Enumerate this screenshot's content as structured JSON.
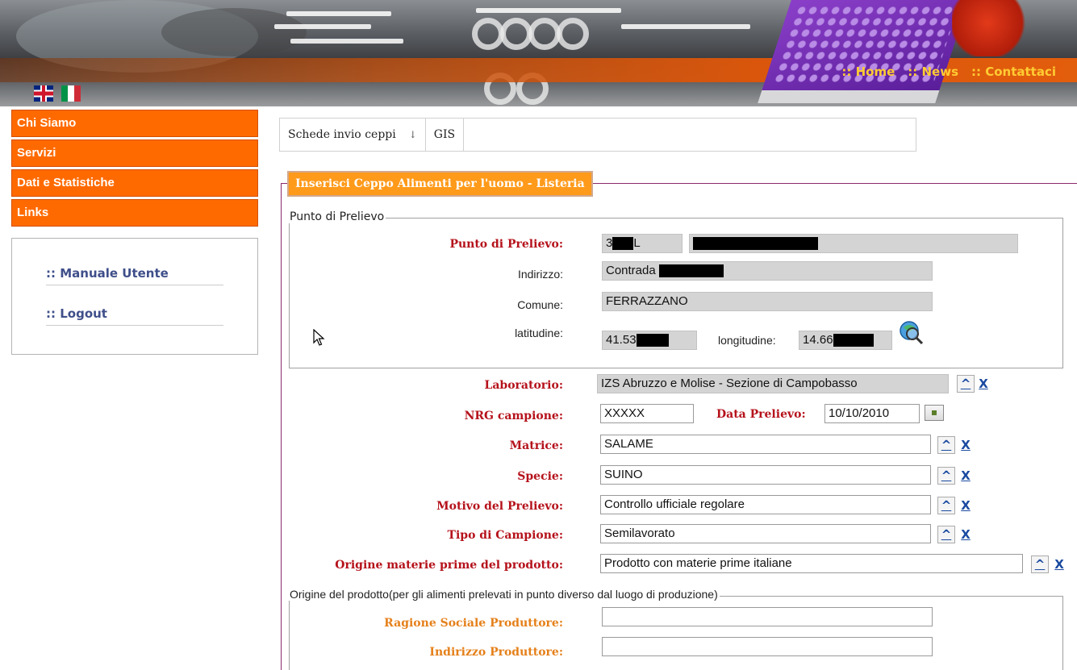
{
  "header": {
    "nav": [
      ":: Home",
      ":: News",
      ":: Contattaci"
    ],
    "flags": [
      "uk-flag-icon",
      "italy-flag-icon"
    ]
  },
  "sidebar": {
    "menu": [
      "Chi Siamo",
      "Servizi",
      "Dati e Statistiche",
      "Links"
    ],
    "user_links": [
      ":: Manuale Utente",
      ":: Logout"
    ]
  },
  "tabs": [
    {
      "label": "Schede invio ceppi",
      "has_dropdown": true
    },
    {
      "label": "GIS",
      "has_dropdown": false
    }
  ],
  "form": {
    "title": "Inserisci Ceppo Alimenti per l'uomo - Listeria",
    "punto_group": {
      "legend": "Punto di Prelievo",
      "punto_label": "Punto di Prelievo:",
      "punto_code_prefix": "3",
      "punto_code_suffix": "L",
      "indirizzo_label": "Indirizzo:",
      "indirizzo_value": "Contrada",
      "comune_label": "Comune:",
      "comune_value": "FERRAZZANO",
      "lat_label": "latitudine:",
      "lat_value": "41.53",
      "lon_label": "longitudine:",
      "lon_value": "14.66"
    },
    "laboratorio_label": "Laboratorio:",
    "laboratorio_value": "IZS Abruzzo e Molise - Sezione di Campobasso",
    "nrg_label": "NRG campione:",
    "nrg_value": "XXXXX",
    "data_label": "Data Prelievo:",
    "data_value": "10/10/2010",
    "matrice_label": "Matrice:",
    "matrice_value": "SALAME",
    "specie_label": "Specie:",
    "specie_value": "SUINO",
    "motivo_label": "Motivo del Prelievo:",
    "motivo_value": "Controllo ufficiale regolare",
    "tipo_label": "Tipo di Campione:",
    "tipo_value": "Semilavorato",
    "origine_mp_label": "Origine materie prime del prodotto:",
    "origine_mp_value": "Prodotto con materie prime italiane",
    "origine_group": {
      "legend": "Origine del prodotto(per gli alimenti prelevati in punto diverso dal luogo di produzione)",
      "ragione_label": "Ragione Sociale Produttore:",
      "ragione_value": "",
      "indirizzo_label": "Indirizzo Produttore:",
      "indirizzo_value": ""
    },
    "button_up": "^",
    "button_clear": "X"
  },
  "colors": {
    "menu_orange": "#ff6a00",
    "title_orange": "#ff9a1a",
    "required_red": "#b5121b",
    "optional_orange": "#e5801a",
    "link_blue": "#3f4f8a",
    "nav_gold": "#ffcc33"
  }
}
